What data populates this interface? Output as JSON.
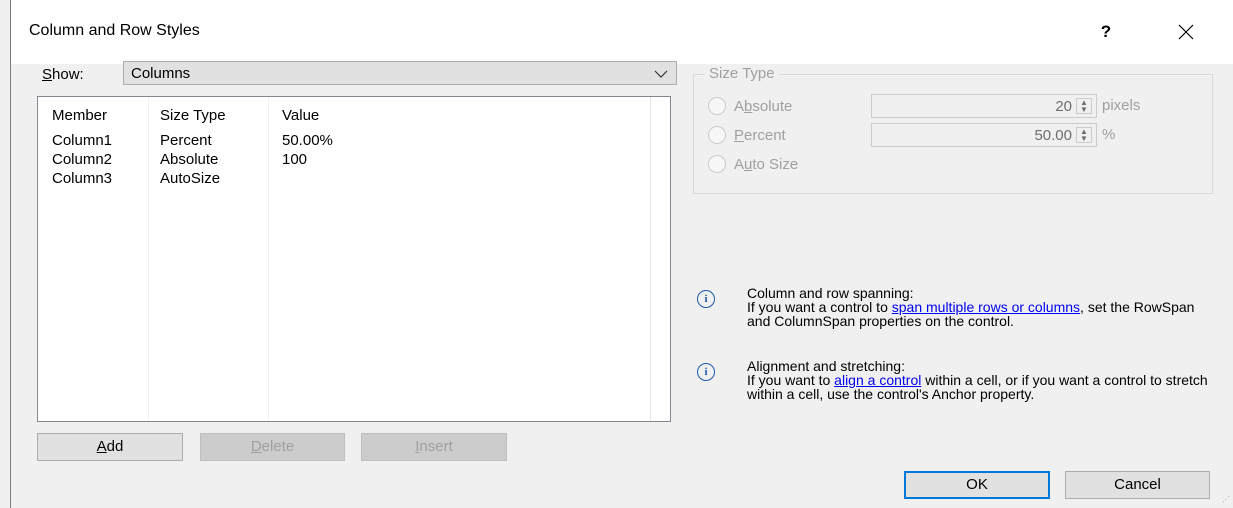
{
  "window": {
    "title": "Column and Row Styles",
    "help_glyph": "?",
    "close_glyph": "✕"
  },
  "show": {
    "label_key": "S",
    "label_rest": "how:",
    "value": "Columns"
  },
  "table": {
    "headers": [
      "Member",
      "Size Type",
      "Value"
    ],
    "rows": [
      [
        "Column1",
        "Percent",
        "50.00%"
      ],
      [
        "Column2",
        "Absolute",
        "100"
      ],
      [
        "Column3",
        "AutoSize",
        ""
      ]
    ]
  },
  "buttons": {
    "add": {
      "pre": "",
      "key": "A",
      "post": "dd"
    },
    "delete": {
      "pre": "",
      "key": "D",
      "post": "elete"
    },
    "insert": {
      "pre": "",
      "key": "I",
      "post": "nsert"
    },
    "ok": "OK",
    "cancel": "Cancel"
  },
  "size_type": {
    "group_title": "Size Type",
    "absolute": {
      "pre": "A",
      "key": "b",
      "post": "solute",
      "value": "20",
      "unit": "pixels"
    },
    "percent": {
      "pre": "",
      "key": "P",
      "post": "ercent",
      "value": "50.00",
      "unit": "%"
    },
    "autosize": {
      "pre": "A",
      "key": "u",
      "post": "to Size"
    }
  },
  "info": [
    {
      "heading": "Column and row spanning:",
      "line2_pre": "If you want a control to ",
      "link": "span multiple rows or columns",
      "line2_post": ", set the RowSpan and ColumnSpan properties on the control."
    },
    {
      "heading": "Alignment and stretching:",
      "line2_pre": "If you want to ",
      "link": "align a control",
      "line2_post": " within a cell, or if you want a control to stretch within a cell, use the control's Anchor property."
    }
  ],
  "colors": {
    "accent": "#0078d7",
    "link": "#0000ee",
    "disabled_text": "#a0a0a0"
  },
  "icons": {
    "info": "info-icon",
    "dropdown": "chevron-down-icon",
    "close": "close-icon",
    "help": "help-icon"
  }
}
